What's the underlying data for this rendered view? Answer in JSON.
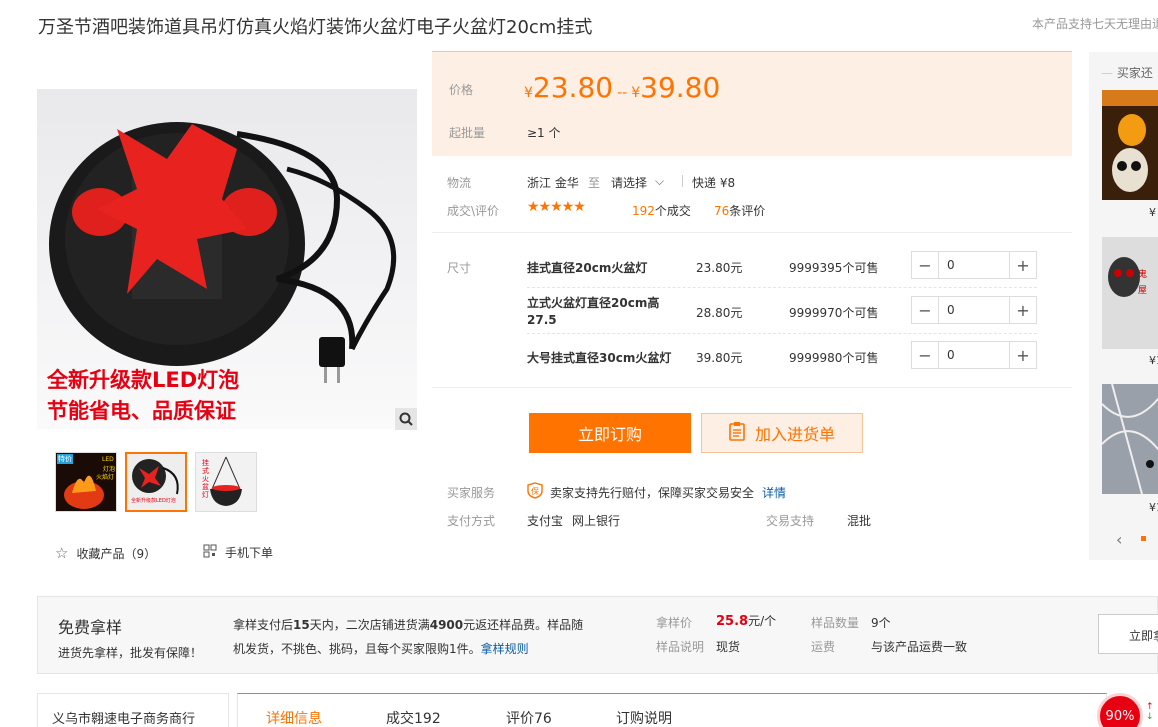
{
  "title": "万圣节酒吧装饰道具吊灯仿真火焰灯装饰火盆灯电子火盆灯20cm挂式",
  "top_note": "本产品支持七天无理由退",
  "gallery": {
    "promo_line1": "全新升级款LED灯泡",
    "promo_line2": "节能省电、品质保证",
    "thumb1_text": "LED",
    "thumb1_text2": "灯泡",
    "thumb1_text3": "火焰灯",
    "thumb1_tag": "特价",
    "thumb3_text": "挂式火盆灯"
  },
  "actions": {
    "favorite": "收藏产品（9）",
    "mobile_order": "手机下单"
  },
  "price": {
    "label": "价格",
    "currency": "¥",
    "low": "23.80",
    "sep": "--",
    "high": "39.80",
    "min_label": "起批量",
    "min_value": "≥1 个"
  },
  "logistics": {
    "label": "物流",
    "from": "浙江 金华",
    "to_word": "至",
    "select": "请选择",
    "express": "快递 ¥8"
  },
  "deals": {
    "label": "成交\\评价",
    "stars": "★★★★★",
    "sold_count": "192",
    "sold_suffix": "个成交",
    "review_count": "76",
    "review_suffix": "条评价",
    "rating": 4.5
  },
  "sku": {
    "label": "尺寸",
    "rows": [
      {
        "name": "挂式直径20cm火盆灯",
        "price": "23.80元",
        "stock": "9999395个可售",
        "qty": "0"
      },
      {
        "name": "立式火盆灯直径20cm高27.5",
        "price": "28.80元",
        "stock": "9999970个可售",
        "qty": "0"
      },
      {
        "name": "大号挂式直径30cm火盆灯",
        "price": "39.80元",
        "stock": "9999980个可售",
        "qty": "0"
      }
    ]
  },
  "buttons": {
    "buy": "立即订购",
    "cart": "加入进货单"
  },
  "service": {
    "label": "买家服务",
    "text": "卖家支持先行赔付，保障买家交易安全",
    "link": "详情",
    "pay_label": "支付方式",
    "pay1": "支付宝",
    "pay2": "网上银行",
    "trade_label": "交易支持",
    "trade_value": "混批"
  },
  "right_col": {
    "head": "买家还",
    "price1": "¥",
    "price2": "¥1",
    "price3": "¥1"
  },
  "sample": {
    "title": "免费拿样",
    "subtitle": "进货先拿样，批发有保障！",
    "desc_a": "拿样支付后",
    "desc_b": "15",
    "desc_c": "天内，二次店铺进货满",
    "desc_d": "4900",
    "desc_e": "元返还样品费。样品随机发货，不挑色、挑码，且每个买家限购1件。",
    "rule_link": "拿样规则",
    "price_label": "拿样价",
    "price_value": "25.8",
    "price_unit": "元/个",
    "qty_label": "样品数量",
    "qty_value": "9个",
    "note_label": "样品说明",
    "note_value": "现货",
    "ship_label": "运费",
    "ship_value": "与该产品运费一致",
    "button": "立即拿"
  },
  "shop": {
    "name": "义乌市翱速电子商务商行"
  },
  "tabs": [
    "详细信息",
    "成交192",
    "评价76",
    "订购说明"
  ],
  "badge": "90%"
}
